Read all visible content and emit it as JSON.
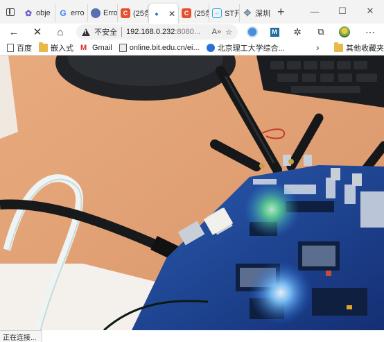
{
  "tabs": [
    {
      "label": "obje",
      "icon": "cat-icon",
      "active": false
    },
    {
      "label": "erro",
      "icon": "google-icon",
      "active": false
    },
    {
      "label": "Erro",
      "icon": "globe-icon",
      "active": false
    },
    {
      "label": "(25条",
      "icon": "csdn-icon",
      "active": false
    },
    {
      "label": "·",
      "icon": "dot-icon",
      "active": true
    },
    {
      "label": "(25条",
      "icon": "csdn-icon",
      "active": false
    },
    {
      "label": "ST开",
      "icon": "bilibili-icon",
      "active": false
    },
    {
      "label": "深圳",
      "icon": "compass-icon",
      "active": false
    }
  ],
  "address": {
    "security_text": "不安全",
    "url_host": "192.168.0.232",
    "url_rest": ":8080..."
  },
  "bookmarks": [
    {
      "label": "百度",
      "icon": "page-icon"
    },
    {
      "label": "嵌入式",
      "icon": "folder-icon"
    },
    {
      "label": "Gmail",
      "icon": "gmail-icon"
    },
    {
      "label": "online.bit.edu.cn/ei...",
      "icon": "page-icon"
    },
    {
      "label": "北京理工大学综合...",
      "icon": "globe-icon"
    }
  ],
  "other_bookmarks": "其他收藏夹",
  "status_text": "正在连接...",
  "colors": {
    "tab_strip": "#f3f3f3",
    "csdn": "#e5512f",
    "bilibili": "#23ade5",
    "board": "#1d3f8f",
    "desk": "#e3a577"
  }
}
